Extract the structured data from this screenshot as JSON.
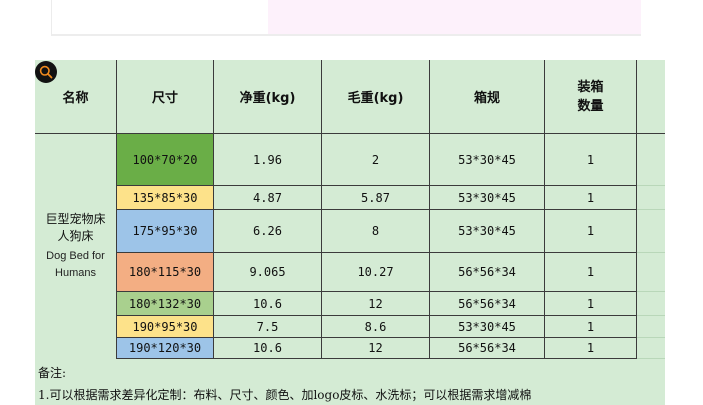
{
  "colors": {
    "sheet_bg": "#d4ebd4",
    "grid_line": "#3b3b3b",
    "size_green": "#6aae47",
    "size_yellow": "#fde28a",
    "size_blue": "#9dc4e8",
    "size_orange": "#f3ae83",
    "size_light_green": "#a9d08e",
    "zoom_icon_color": "#f08a1e",
    "top_right_bg": "#fdf1fb"
  },
  "zoom": {
    "icon": "zoom-in-icon"
  },
  "table": {
    "headers": {
      "name": "名称",
      "size": "尺寸",
      "net_weight": "净重(kg)",
      "gross_weight": "毛重(kg)",
      "carton": "箱规",
      "qty_line1": "装箱",
      "qty_line2": "数量"
    },
    "product": {
      "name_cn_line1": "巨型宠物床",
      "name_cn_line2": "人狗床",
      "name_en_line1": "Dog Bed for",
      "name_en_line2": "Humans"
    },
    "rows": [
      {
        "size": "100*70*20",
        "net": "1.96",
        "gross": "2",
        "carton": "53*30*45",
        "qty": "1",
        "color": "green"
      },
      {
        "size": "135*85*30",
        "net": "4.87",
        "gross": "5.87",
        "carton": "53*30*45",
        "qty": "1",
        "color": "yellow"
      },
      {
        "size": "175*95*30",
        "net": "6.26",
        "gross": "8",
        "carton": "53*30*45",
        "qty": "1",
        "color": "blue"
      },
      {
        "size": "180*115*30",
        "net": "9.065",
        "gross": "10.27",
        "carton": "56*56*34",
        "qty": "1",
        "color": "orange"
      },
      {
        "size": "180*132*30",
        "net": "10.6",
        "gross": "12",
        "carton": "56*56*34",
        "qty": "1",
        "color": "light_green"
      },
      {
        "size": "190*95*30",
        "net": "7.5",
        "gross": "8.6",
        "carton": "53*30*45",
        "qty": "1",
        "color": "yellow"
      },
      {
        "size": "190*120*30",
        "net": "10.6",
        "gross": "12",
        "carton": "56*56*34",
        "qty": "1",
        "color": "blue"
      }
    ]
  },
  "notes": {
    "title": "备注:",
    "line1": "1.可以根据需求差异化定制：布料、尺寸、颜色、加logo皮标、水洗标；可以根据需求增减棉"
  }
}
